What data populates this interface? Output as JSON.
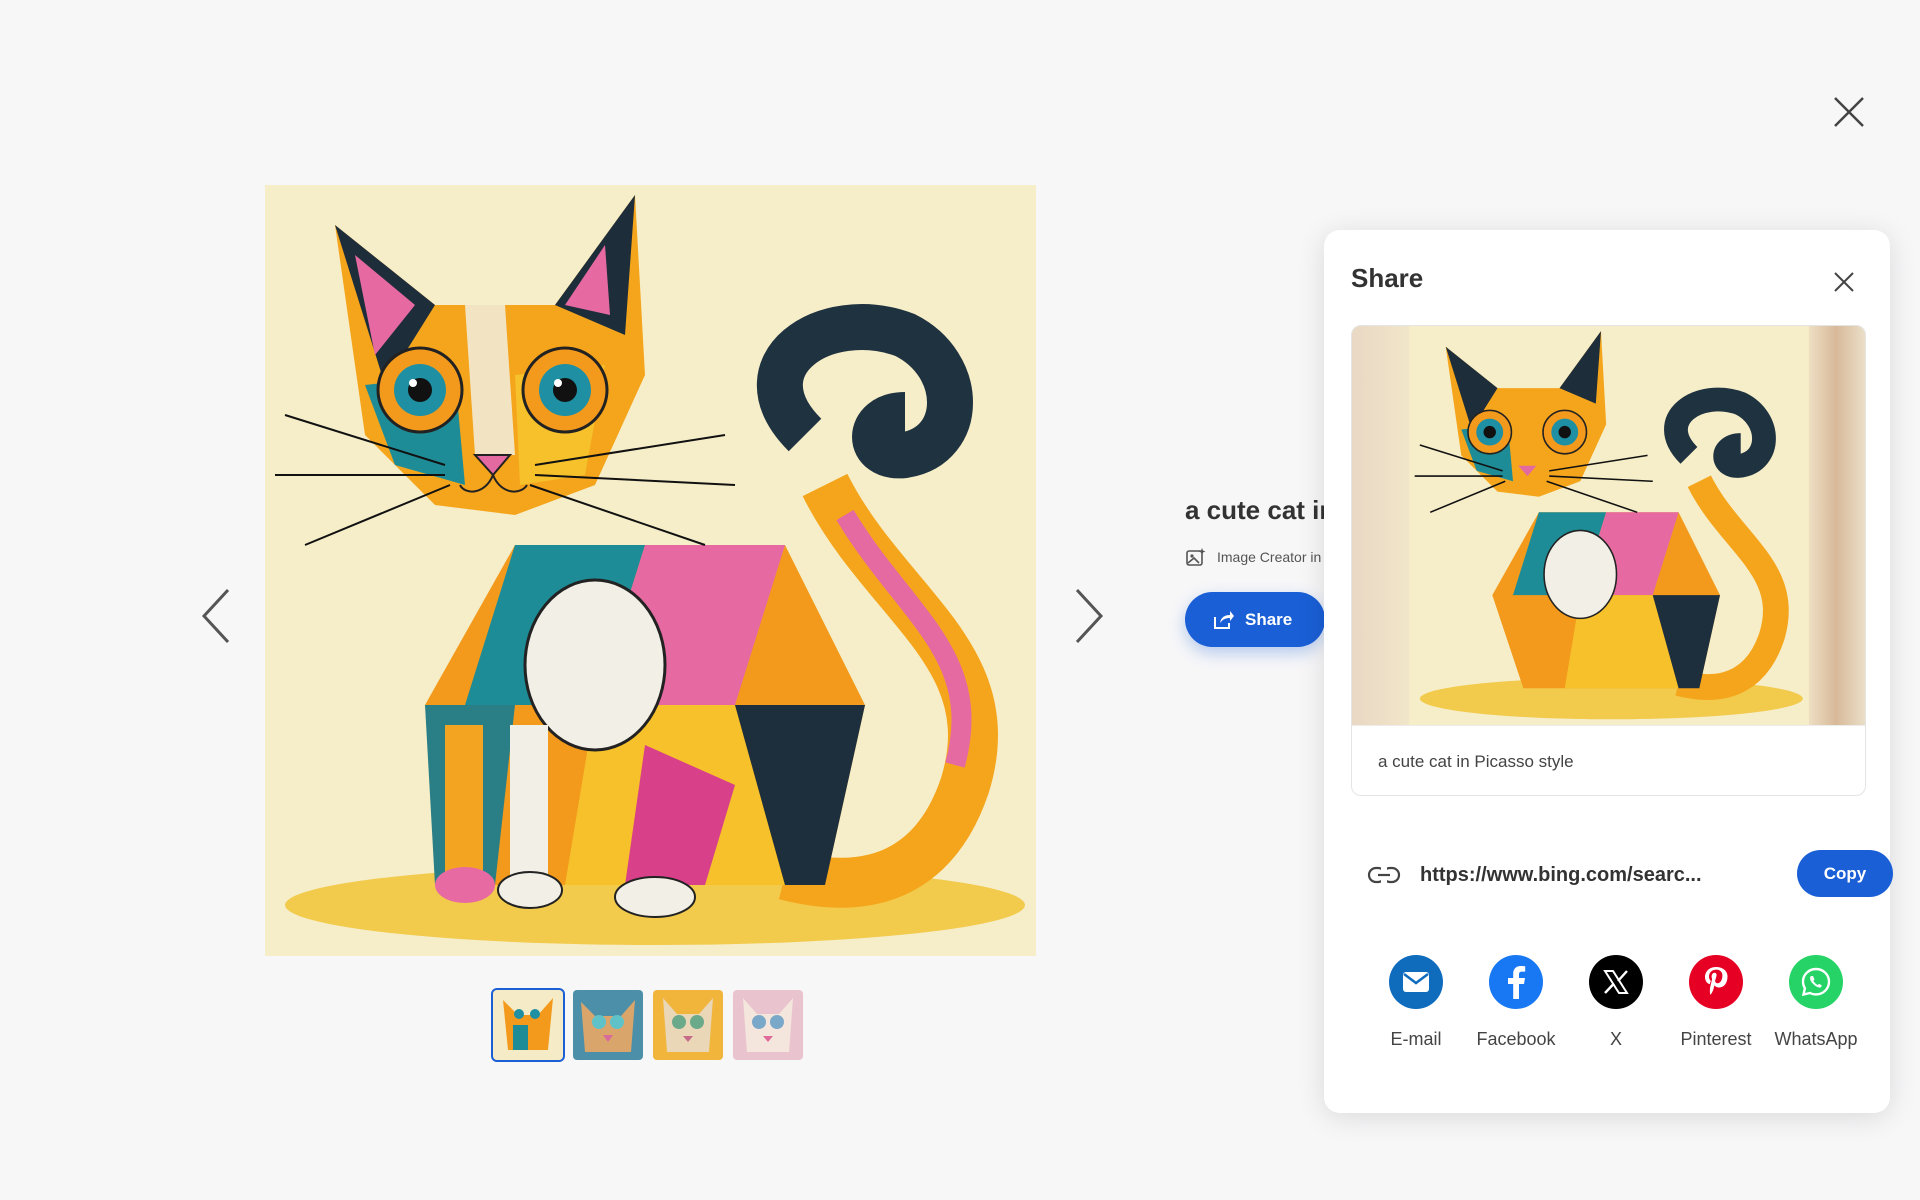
{
  "viewer": {
    "close_icon": "close-icon",
    "prev_icon": "chevron-left-icon",
    "next_icon": "chevron-right-icon",
    "thumbnails": [
      {
        "label": "thumb-1",
        "active": true
      },
      {
        "label": "thumb-2",
        "active": false
      },
      {
        "label": "thumb-3",
        "active": false
      },
      {
        "label": "thumb-4",
        "active": false
      }
    ]
  },
  "details": {
    "title": "a cute cat in",
    "creator": "Image Creator in",
    "share_label": "Share"
  },
  "share_panel": {
    "title": "Share",
    "caption": "a cute cat in Picasso style",
    "url": "https://www.bing.com/searc...",
    "copy_label": "Copy",
    "targets": [
      {
        "label": "E-mail",
        "icon": "email-icon",
        "color": "#0f6cbd"
      },
      {
        "label": "Facebook",
        "icon": "facebook-icon",
        "color": "#1877f2"
      },
      {
        "label": "X",
        "icon": "x-icon",
        "color": "#000000"
      },
      {
        "label": "Pinterest",
        "icon": "pinterest-icon",
        "color": "#e60023"
      },
      {
        "label": "WhatsApp",
        "icon": "whatsapp-icon",
        "color": "#25d366"
      }
    ]
  },
  "colors": {
    "accent": "#1a5fd6",
    "background": "#f7f7f8"
  }
}
